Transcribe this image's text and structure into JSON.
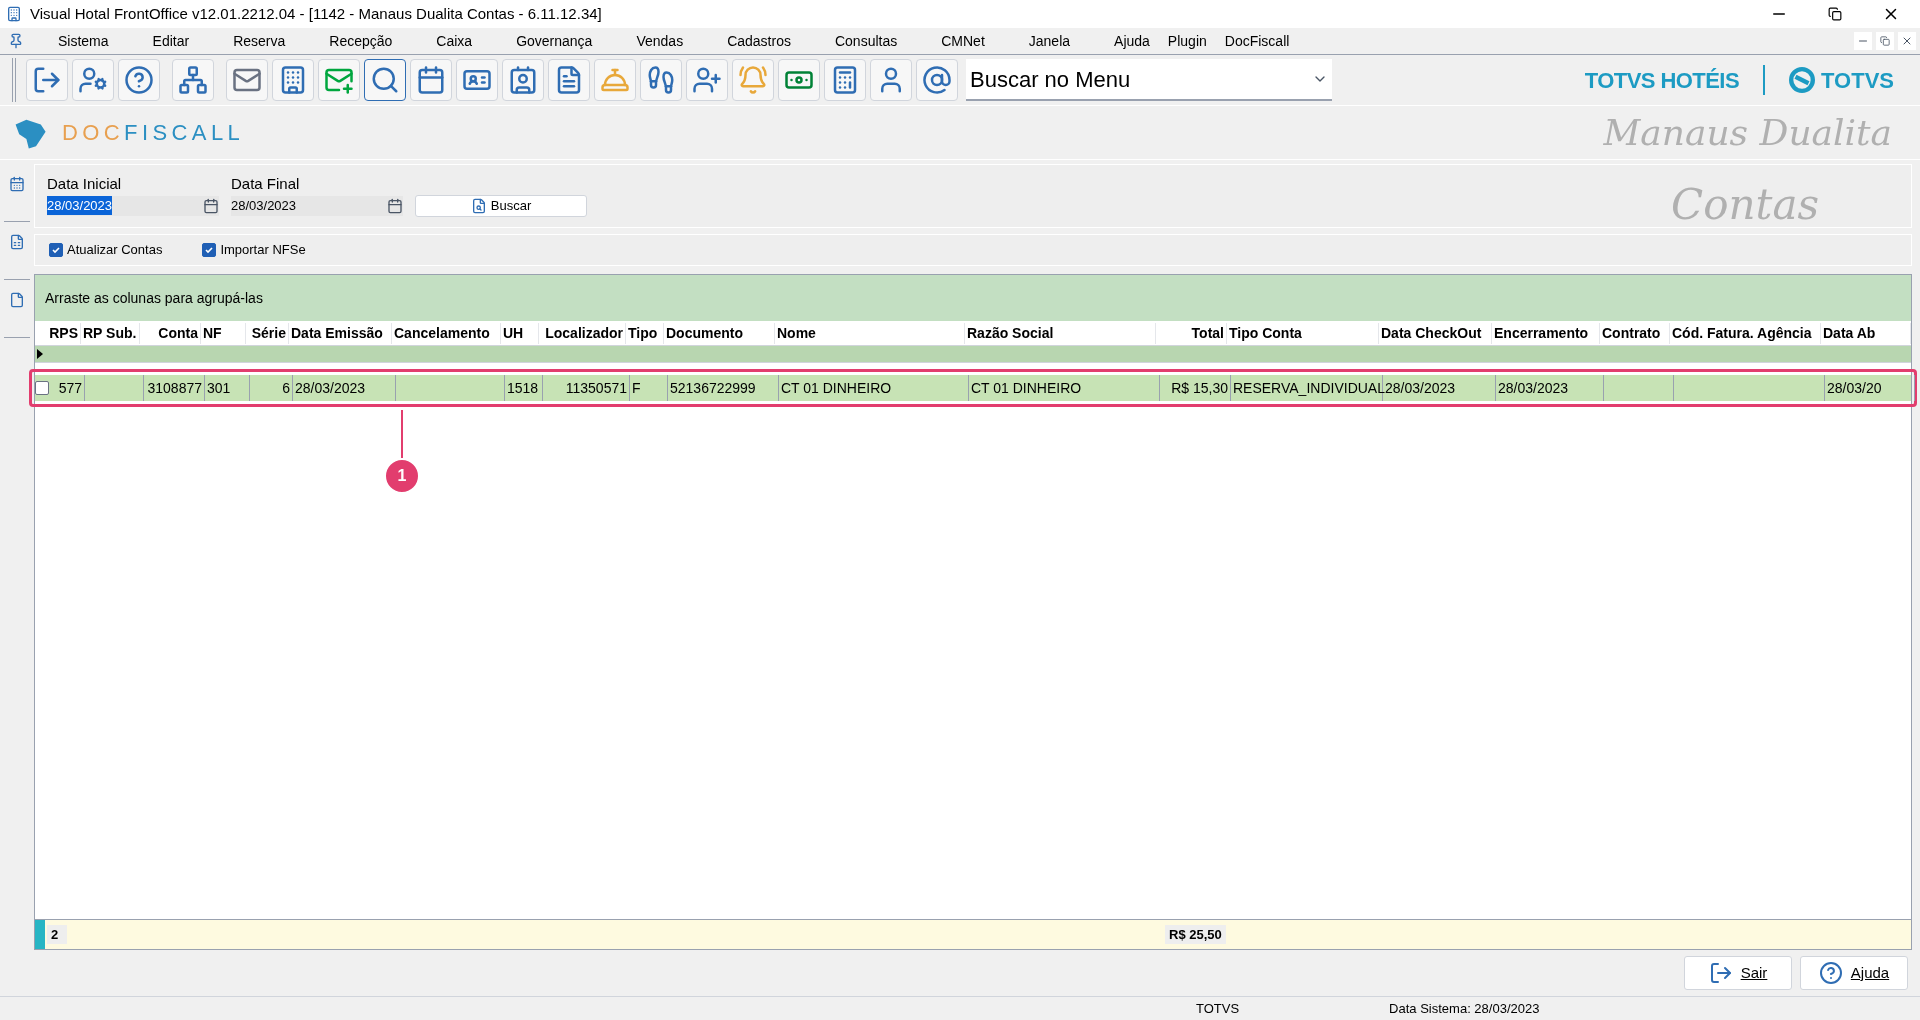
{
  "window": {
    "title": "Visual Hotal FrontOffice v12.01.2212.04 - [1142 - Manaus Dualita Contas - 6.11.12.34]"
  },
  "menu": [
    "Sistema",
    "Editar",
    "Reserva",
    "Recepção",
    "Caixa",
    "Governança",
    "Vendas",
    "Cadastros",
    "Consultas",
    "CMNet",
    "Janela",
    "Ajuda",
    "Plugin",
    "DocFiscall"
  ],
  "menu_search": {
    "value": "Buscar no Menu"
  },
  "brand": {
    "product": "TOTVS HOTÉIS",
    "company": "TOTVS",
    "module": "DOCFISCALL",
    "hotel": "Manaus Dualita",
    "screen": "Contas"
  },
  "filters": {
    "start_label": "Data Inicial",
    "start_value": "28/03/2023",
    "end_label": "Data Final",
    "end_value": "28/03/2023",
    "search_button": "Buscar"
  },
  "options": [
    {
      "label": "Atualizar Contas",
      "checked": true
    },
    {
      "label": "Importar NFSe",
      "checked": true
    }
  ],
  "grid": {
    "group_hint": "Arraste as colunas para agrupá-las",
    "columns": [
      "RPS",
      "RP Sub.",
      "Conta",
      "NF",
      "Série",
      "Data Emissão",
      "Cancelamento",
      "UH",
      "Localizador",
      "Tipo",
      "Documento",
      "Nome",
      "Razão Social",
      "Total",
      "Tipo Conta",
      "Data CheckOut",
      "Encerramento",
      "Contrato",
      "Cód. Fatura. Agência",
      "Data Ab"
    ],
    "rows": [
      {
        "checked": false,
        "highlighted": true,
        "cells": [
          "577",
          "",
          "3108877",
          "301",
          "6",
          "28/03/2023",
          "",
          "1518",
          "11350571",
          "F",
          "52136722999",
          "CT 01 DINHEIRO",
          "CT 01 DINHEIRO",
          "R$ 15,30",
          "RESERVA_INDIVIDUAL",
          "28/03/2023",
          "28/03/2023",
          "",
          "",
          "28/03/20"
        ]
      }
    ],
    "footer": {
      "count": "2",
      "total": "R$ 25,50"
    }
  },
  "callout": {
    "label": "1"
  },
  "buttons": [
    {
      "label": "Sair",
      "kind": "exit"
    },
    {
      "label": "Ajuda",
      "kind": "help"
    }
  ],
  "status_bar": [
    "TOTVS",
    "Data Sistema: 28/03/2023"
  ]
}
